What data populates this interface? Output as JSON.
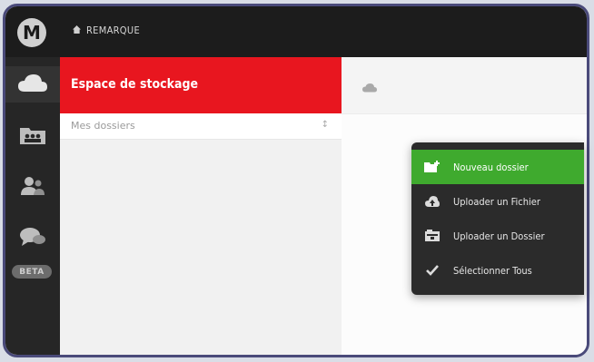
{
  "topbar": {
    "logo_letter": "M",
    "app_title": "REMARQUE"
  },
  "sidebar": {
    "items": [
      {
        "icon": "cloud-icon"
      },
      {
        "icon": "folders-icon"
      },
      {
        "icon": "contacts-icon"
      },
      {
        "icon": "chat-icon"
      }
    ],
    "beta_label": "BETA"
  },
  "panel": {
    "title": "Espace de stockage",
    "selector_value": "Mes dossiers",
    "selector_arrow": "↕"
  },
  "context_menu": {
    "items": [
      {
        "label": "Nouveau dossier",
        "icon": "new-folder-icon"
      },
      {
        "label": "Uploader un Fichier",
        "icon": "upload-file-icon"
      },
      {
        "label": "Uploader un Dossier",
        "icon": "upload-folder-icon"
      },
      {
        "label": "Sélectionner Tous",
        "icon": "checkmark-icon"
      }
    ]
  },
  "colors": {
    "accent_red": "#e8161f",
    "menu_active_green": "#3faa2e",
    "sidebar_dark": "#262626"
  }
}
